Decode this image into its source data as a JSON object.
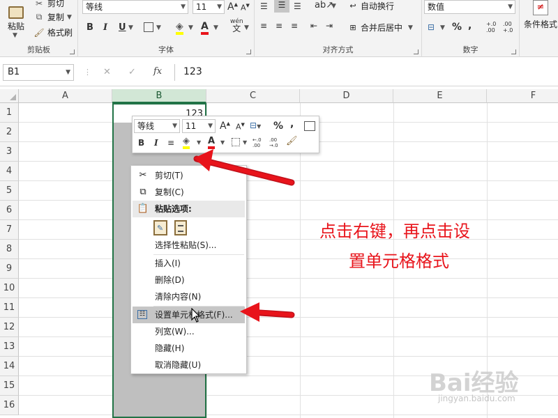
{
  "ribbon": {
    "clipboard": {
      "cut": "剪切",
      "copy": "复制",
      "paste": "粘贴",
      "format_painter": "格式刷",
      "label": "剪贴板"
    },
    "font": {
      "name": "等线",
      "size": "11",
      "bold": "B",
      "italic": "I",
      "underline": "U",
      "wen": "wén",
      "wen_char": "文",
      "label": "字体"
    },
    "alignment": {
      "wrap": "自动换行",
      "merge": "合并后居中",
      "label": "对齐方式"
    },
    "number": {
      "format": "数值",
      "percent": "%",
      "comma": ",",
      "inc_dec": "+.0 .00",
      "dec_dec": ".00 +.0",
      "label": "数字"
    },
    "styles": {
      "conditional": "条件格式"
    }
  },
  "formula_bar": {
    "name_box": "B1",
    "cancel": "✕",
    "enter": "✓",
    "fx": "fx",
    "value": "123"
  },
  "grid": {
    "columns": [
      "A",
      "B",
      "C",
      "D",
      "E",
      "F"
    ],
    "rows": [
      "1",
      "2",
      "3",
      "4",
      "5",
      "6",
      "7",
      "8",
      "9",
      "10",
      "11",
      "12",
      "13",
      "14",
      "15",
      "16"
    ],
    "b1_value": "123"
  },
  "mini_toolbar": {
    "font": "等线",
    "size": "11",
    "percent": "%",
    "comma": ",",
    "bold": "B",
    "italic": "I"
  },
  "context_menu": {
    "items": [
      {
        "label": "剪切(T)"
      },
      {
        "label": "复制(C)"
      },
      {
        "label": "粘贴选项:"
      },
      {
        "label": "选择性粘贴(S)..."
      },
      {
        "label": "插入(I)"
      },
      {
        "label": "删除(D)"
      },
      {
        "label": "清除内容(N)"
      },
      {
        "label": "设置单元格格式(F)..."
      },
      {
        "label": "列宽(W)..."
      },
      {
        "label": "隐藏(H)"
      },
      {
        "label": "取消隐藏(U)"
      }
    ]
  },
  "annotation": {
    "line1": "点击右键，再点击设",
    "line2": "置单元格格式",
    "color": "#e8141b"
  },
  "watermark": {
    "brand": "Bai经验",
    "url": "jingyan.baidu.com"
  },
  "colors": {
    "excel_green": "#217346",
    "selection_gray": "#bfbfbf"
  }
}
